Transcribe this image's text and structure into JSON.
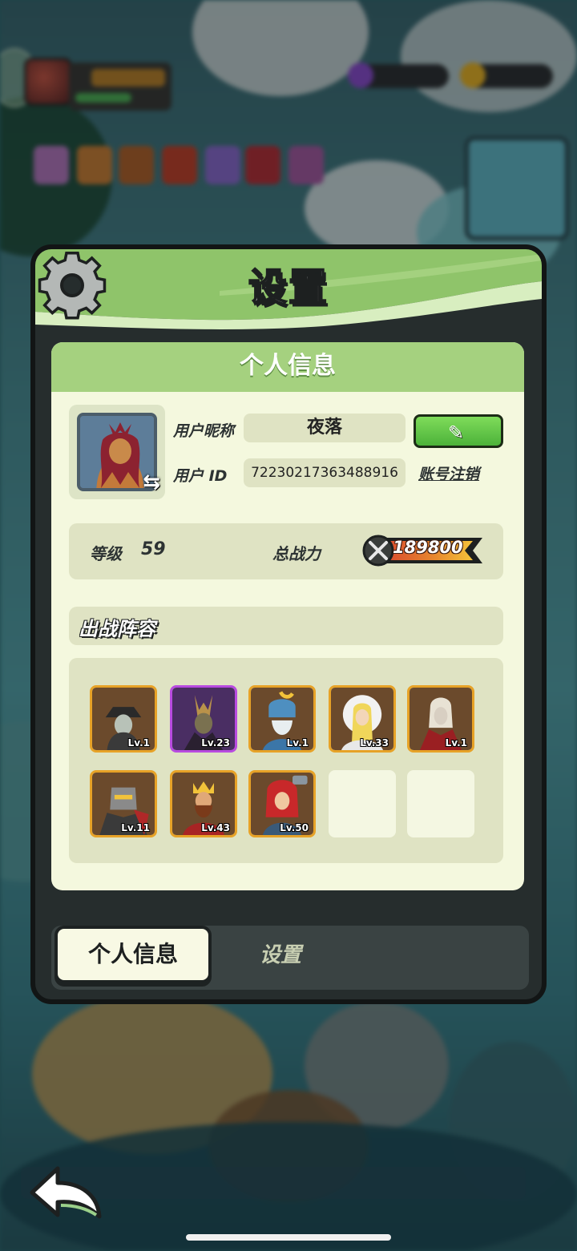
{
  "dialog": {
    "title": "设置",
    "panel_title": "个人信息",
    "profile": {
      "nickname_label": "用户昵称",
      "nickname": "夜落",
      "user_id_label": "用户 ID",
      "user_id": "72230217363488916",
      "cancel_account": "账号注销",
      "edit_icon": "pencil-icon",
      "swap_icon": "swap-arrows-icon"
    },
    "stats": {
      "level_label": "等级",
      "level": "59",
      "power_label": "总战力",
      "power": "189800",
      "power_icon": "crossed-swords-icon"
    },
    "lineup": {
      "title": "出战阵容",
      "heroes": [
        {
          "level": "Lv.1",
          "rarity": "legendary"
        },
        {
          "level": "Lv.23",
          "rarity": "epic"
        },
        {
          "level": "Lv.1",
          "rarity": "legendary"
        },
        {
          "level": "Lv.33",
          "rarity": "legendary"
        },
        {
          "level": "Lv.1",
          "rarity": "legendary"
        },
        {
          "level": "Lv.11",
          "rarity": "legendary"
        },
        {
          "level": "Lv.43",
          "rarity": "legendary"
        },
        {
          "level": "Lv.50",
          "rarity": "legendary"
        },
        {
          "level": "",
          "rarity": "empty"
        },
        {
          "level": "",
          "rarity": "empty"
        }
      ]
    },
    "tabs": [
      {
        "label": "个人信息",
        "active": true
      },
      {
        "label": "设置",
        "active": false
      }
    ]
  },
  "colors": {
    "header_green": "#8fc46a",
    "panel_bg": "#f4f8de",
    "field_bg": "#dfe3c3",
    "legend_border": "#e7a227",
    "epic_border": "#b84be0",
    "button_green": "#5cc044"
  }
}
